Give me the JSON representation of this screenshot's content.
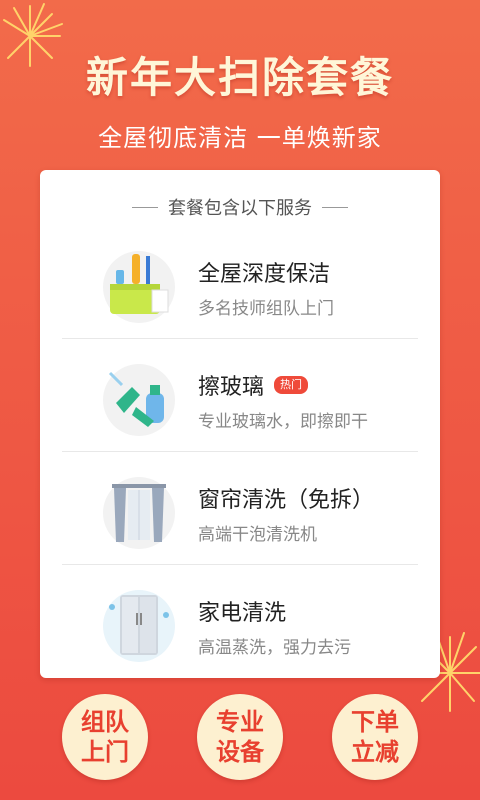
{
  "header": {
    "title": "新年大扫除套餐",
    "subtitle": "全屋彻底清洁 一单焕新家"
  },
  "card": {
    "heading": "套餐包含以下服务",
    "items": [
      {
        "name": "全屋深度保洁",
        "desc": "多名技师组队上门",
        "icon": "cleaning-bucket-icon",
        "tag": ""
      },
      {
        "name": "擦玻璃",
        "desc": "专业玻璃水，即擦即干",
        "icon": "window-spray-icon",
        "tag": "热门"
      },
      {
        "name": "窗帘清洗（免拆）",
        "desc": "高端干泡清洗机",
        "icon": "curtain-icon",
        "tag": ""
      },
      {
        "name": "家电清洗",
        "desc": "高温蒸洗，强力去污",
        "icon": "refrigerator-icon",
        "tag": ""
      }
    ]
  },
  "badges": [
    {
      "text": "组队上门"
    },
    {
      "text": "专业设备"
    },
    {
      "text": "下单立减"
    }
  ],
  "colors": {
    "background": "#ef5b45",
    "title": "#fff6d8",
    "badge_bg": "#fdf0d0",
    "badge_text": "#e8402f",
    "hot_tag": "#ef4a3a"
  }
}
